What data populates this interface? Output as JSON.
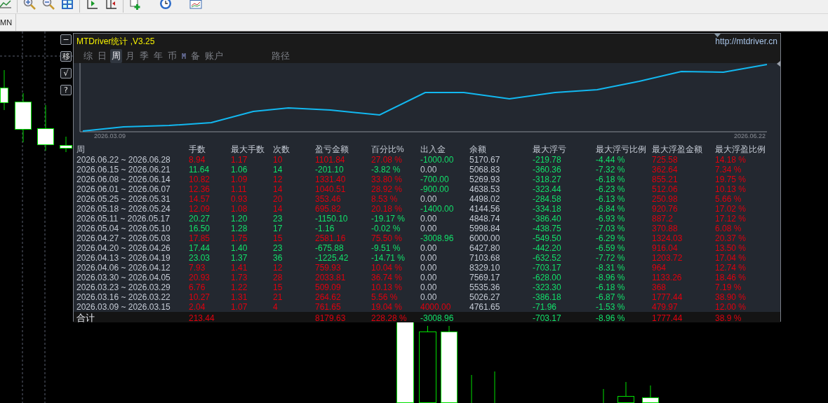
{
  "toolbar": {
    "period_label": "MN"
  },
  "panel": {
    "title": "MTDriver统计 ,V3.25",
    "url": "http://mtdriver.cn",
    "side_buttons": [
      "−",
      "移",
      "√",
      "?"
    ],
    "tabs": [
      {
        "label": "综",
        "kind": "char",
        "selected": false
      },
      {
        "label": "日",
        "kind": "char",
        "selected": false
      },
      {
        "label": "周",
        "kind": "char",
        "selected": true
      },
      {
        "label": "月",
        "kind": "char",
        "selected": false
      },
      {
        "label": "季",
        "kind": "char",
        "selected": false
      },
      {
        "label": "年",
        "kind": "char",
        "selected": false
      },
      {
        "label": "币",
        "kind": "char",
        "selected": false
      },
      {
        "label": "M",
        "kind": "mark",
        "selected": false
      },
      {
        "label": "备",
        "kind": "char",
        "selected": false
      },
      {
        "label": "账户",
        "kind": "char",
        "selected": false
      },
      {
        "label": "路径",
        "kind": "char",
        "selected": false
      }
    ],
    "chart": {
      "start_label": "2026.03.09",
      "end_label": "2026.06.22"
    },
    "table": {
      "columns": [
        "周",
        "手数",
        "最大手数",
        "次数",
        "盈亏金额",
        "百分比%",
        "出入金",
        "余额",
        "最大浮亏",
        "最大浮亏比例",
        "最大浮盈金额",
        "最大浮盈比例"
      ],
      "rows": [
        {
          "cells": [
            {
              "text": "2026.06.22 ~ 2026.06.28",
              "color": "#c4cad4"
            },
            {
              "text": "8.94",
              "color": "#e0000e"
            },
            {
              "text": "1.17",
              "color": "#e0000e"
            },
            {
              "text": "10",
              "color": "#e0000e"
            },
            {
              "text": "1101.84",
              "color": "#e0000e"
            },
            {
              "text": "27.08 %",
              "color": "#e0000e"
            },
            {
              "text": "-1000.00",
              "color": "#12e06a"
            },
            {
              "text": "5170.67",
              "color": "#c4cad4"
            },
            {
              "text": "-219.78",
              "color": "#12e06a"
            },
            {
              "text": "-4.44 %",
              "color": "#12e06a"
            },
            {
              "text": "725.58",
              "color": "#e0000e"
            },
            {
              "text": "14.18 %",
              "color": "#e0000e"
            }
          ]
        },
        {
          "cells": [
            {
              "text": "2026.06.15 ~ 2026.06.21",
              "color": "#c4cad4"
            },
            {
              "text": "11.64",
              "color": "#12e06a"
            },
            {
              "text": "1.06",
              "color": "#12e06a"
            },
            {
              "text": "14",
              "color": "#12e06a"
            },
            {
              "text": "-201.10",
              "color": "#12e06a"
            },
            {
              "text": "-3.82 %",
              "color": "#12e06a"
            },
            {
              "text": "0.00",
              "color": "#c4cad4"
            },
            {
              "text": "5068.83",
              "color": "#c4cad4"
            },
            {
              "text": "-360.36",
              "color": "#12e06a"
            },
            {
              "text": "-7.32 %",
              "color": "#12e06a"
            },
            {
              "text": "362.64",
              "color": "#e0000e"
            },
            {
              "text": "7.34 %",
              "color": "#e0000e"
            }
          ]
        },
        {
          "cells": [
            {
              "text": "2026.06.08 ~ 2026.06.14",
              "color": "#c4cad4"
            },
            {
              "text": "10.82",
              "color": "#e0000e"
            },
            {
              "text": "1.09",
              "color": "#e0000e"
            },
            {
              "text": "12",
              "color": "#e0000e"
            },
            {
              "text": "1331.40",
              "color": "#e0000e"
            },
            {
              "text": "33.80 %",
              "color": "#e0000e"
            },
            {
              "text": "-700.00",
              "color": "#12e06a"
            },
            {
              "text": "5269.93",
              "color": "#c4cad4"
            },
            {
              "text": "-318.27",
              "color": "#12e06a"
            },
            {
              "text": "-6.18 %",
              "color": "#12e06a"
            },
            {
              "text": "855.21",
              "color": "#e0000e"
            },
            {
              "text": "19.75 %",
              "color": "#e0000e"
            }
          ]
        },
        {
          "cells": [
            {
              "text": "2026.06.01 ~ 2026.06.07",
              "color": "#c4cad4"
            },
            {
              "text": "12.36",
              "color": "#e0000e"
            },
            {
              "text": "1.11",
              "color": "#e0000e"
            },
            {
              "text": "14",
              "color": "#e0000e"
            },
            {
              "text": "1040.51",
              "color": "#e0000e"
            },
            {
              "text": "28.92 %",
              "color": "#e0000e"
            },
            {
              "text": "-900.00",
              "color": "#12e06a"
            },
            {
              "text": "4638.53",
              "color": "#c4cad4"
            },
            {
              "text": "-323.44",
              "color": "#12e06a"
            },
            {
              "text": "-6.23 %",
              "color": "#12e06a"
            },
            {
              "text": "512.06",
              "color": "#e0000e"
            },
            {
              "text": "10.13 %",
              "color": "#e0000e"
            }
          ]
        },
        {
          "cells": [
            {
              "text": "2026.05.25 ~ 2026.05.31",
              "color": "#c4cad4"
            },
            {
              "text": "14.57",
              "color": "#e0000e"
            },
            {
              "text": "0.93",
              "color": "#e0000e"
            },
            {
              "text": "20",
              "color": "#e0000e"
            },
            {
              "text": "353.46",
              "color": "#e0000e"
            },
            {
              "text": "8.53 %",
              "color": "#e0000e"
            },
            {
              "text": "0.00",
              "color": "#c4cad4"
            },
            {
              "text": "4498.02",
              "color": "#c4cad4"
            },
            {
              "text": "-284.58",
              "color": "#12e06a"
            },
            {
              "text": "-6.13 %",
              "color": "#12e06a"
            },
            {
              "text": "250.98",
              "color": "#e0000e"
            },
            {
              "text": "5.66 %",
              "color": "#e0000e"
            }
          ]
        },
        {
          "cells": [
            {
              "text": "2026.05.18 ~ 2026.05.24",
              "color": "#c4cad4"
            },
            {
              "text": "12.09",
              "color": "#e0000e"
            },
            {
              "text": "1.08",
              "color": "#e0000e"
            },
            {
              "text": "14",
              "color": "#e0000e"
            },
            {
              "text": "695.82",
              "color": "#e0000e"
            },
            {
              "text": "20.18 %",
              "color": "#e0000e"
            },
            {
              "text": "-1400.00",
              "color": "#12e06a"
            },
            {
              "text": "4144.56",
              "color": "#c4cad4"
            },
            {
              "text": "-334.18",
              "color": "#12e06a"
            },
            {
              "text": "-6.84 %",
              "color": "#12e06a"
            },
            {
              "text": "920.76",
              "color": "#e0000e"
            },
            {
              "text": "17.02 %",
              "color": "#e0000e"
            }
          ]
        },
        {
          "cells": [
            {
              "text": "2026.05.11 ~ 2026.05.17",
              "color": "#c4cad4"
            },
            {
              "text": "20.27",
              "color": "#12e06a"
            },
            {
              "text": "1.20",
              "color": "#12e06a"
            },
            {
              "text": "23",
              "color": "#12e06a"
            },
            {
              "text": "-1150.10",
              "color": "#12e06a"
            },
            {
              "text": "-19.17 %",
              "color": "#12e06a"
            },
            {
              "text": "0.00",
              "color": "#c4cad4"
            },
            {
              "text": "4848.74",
              "color": "#c4cad4"
            },
            {
              "text": "-386.40",
              "color": "#12e06a"
            },
            {
              "text": "-6.93 %",
              "color": "#12e06a"
            },
            {
              "text": "887.2",
              "color": "#e0000e"
            },
            {
              "text": "17.12 %",
              "color": "#e0000e"
            }
          ]
        },
        {
          "cells": [
            {
              "text": "2026.05.04 ~ 2026.05.10",
              "color": "#c4cad4"
            },
            {
              "text": "16.50",
              "color": "#12e06a"
            },
            {
              "text": "1.28",
              "color": "#12e06a"
            },
            {
              "text": "17",
              "color": "#12e06a"
            },
            {
              "text": "-1.16",
              "color": "#12e06a"
            },
            {
              "text": "-0.02 %",
              "color": "#12e06a"
            },
            {
              "text": "0.00",
              "color": "#c4cad4"
            },
            {
              "text": "5998.84",
              "color": "#c4cad4"
            },
            {
              "text": "-438.75",
              "color": "#12e06a"
            },
            {
              "text": "-7.03 %",
              "color": "#12e06a"
            },
            {
              "text": "370.88",
              "color": "#e0000e"
            },
            {
              "text": "6.08 %",
              "color": "#e0000e"
            }
          ]
        },
        {
          "cells": [
            {
              "text": "2026.04.27 ~ 2026.05.03",
              "color": "#c4cad4"
            },
            {
              "text": "17.85",
              "color": "#e0000e"
            },
            {
              "text": "1.75",
              "color": "#e0000e"
            },
            {
              "text": "15",
              "color": "#e0000e"
            },
            {
              "text": "2581.16",
              "color": "#e0000e"
            },
            {
              "text": "75.50 %",
              "color": "#e0000e"
            },
            {
              "text": "-3008.96",
              "color": "#12e06a"
            },
            {
              "text": "6000.00",
              "color": "#c4cad4"
            },
            {
              "text": "-549.50",
              "color": "#12e06a"
            },
            {
              "text": "-6.29 %",
              "color": "#12e06a"
            },
            {
              "text": "1324.03",
              "color": "#e0000e"
            },
            {
              "text": "20.37 %",
              "color": "#e0000e"
            }
          ]
        },
        {
          "cells": [
            {
              "text": "2026.04.20 ~ 2026.04.26",
              "color": "#c4cad4"
            },
            {
              "text": "17.44",
              "color": "#12e06a"
            },
            {
              "text": "1.40",
              "color": "#12e06a"
            },
            {
              "text": "23",
              "color": "#12e06a"
            },
            {
              "text": "-675.88",
              "color": "#12e06a"
            },
            {
              "text": "-9.51 %",
              "color": "#12e06a"
            },
            {
              "text": "0.00",
              "color": "#c4cad4"
            },
            {
              "text": "6427.80",
              "color": "#c4cad4"
            },
            {
              "text": "-442.20",
              "color": "#12e06a"
            },
            {
              "text": "-6.59 %",
              "color": "#12e06a"
            },
            {
              "text": "916.04",
              "color": "#e0000e"
            },
            {
              "text": "13.50 %",
              "color": "#e0000e"
            }
          ]
        },
        {
          "cells": [
            {
              "text": "2026.04.13 ~ 2026.04.19",
              "color": "#c4cad4"
            },
            {
              "text": "23.03",
              "color": "#12e06a"
            },
            {
              "text": "1.37",
              "color": "#12e06a"
            },
            {
              "text": "36",
              "color": "#12e06a"
            },
            {
              "text": "-1225.42",
              "color": "#12e06a"
            },
            {
              "text": "-14.71 %",
              "color": "#12e06a"
            },
            {
              "text": "0.00",
              "color": "#c4cad4"
            },
            {
              "text": "7103.68",
              "color": "#c4cad4"
            },
            {
              "text": "-632.52",
              "color": "#12e06a"
            },
            {
              "text": "-7.72 %",
              "color": "#12e06a"
            },
            {
              "text": "1203.72",
              "color": "#e0000e"
            },
            {
              "text": "17.04 %",
              "color": "#e0000e"
            }
          ]
        },
        {
          "cells": [
            {
              "text": "2026.04.06 ~ 2026.04.12",
              "color": "#c4cad4"
            },
            {
              "text": "7.93",
              "color": "#e0000e"
            },
            {
              "text": "1.41",
              "color": "#e0000e"
            },
            {
              "text": "12",
              "color": "#e0000e"
            },
            {
              "text": "759.93",
              "color": "#e0000e"
            },
            {
              "text": "10.04 %",
              "color": "#e0000e"
            },
            {
              "text": "0.00",
              "color": "#c4cad4"
            },
            {
              "text": "8329.10",
              "color": "#c4cad4"
            },
            {
              "text": "-703.17",
              "color": "#12e06a"
            },
            {
              "text": "-8.31 %",
              "color": "#12e06a"
            },
            {
              "text": "964",
              "color": "#e0000e"
            },
            {
              "text": "12.74 %",
              "color": "#e0000e"
            }
          ]
        },
        {
          "cells": [
            {
              "text": "2026.03.30 ~ 2026.04.05",
              "color": "#c4cad4"
            },
            {
              "text": "20.93",
              "color": "#e0000e"
            },
            {
              "text": "1.73",
              "color": "#e0000e"
            },
            {
              "text": "28",
              "color": "#e0000e"
            },
            {
              "text": "2033.81",
              "color": "#e0000e"
            },
            {
              "text": "36.74 %",
              "color": "#e0000e"
            },
            {
              "text": "0.00",
              "color": "#c4cad4"
            },
            {
              "text": "7569.17",
              "color": "#c4cad4"
            },
            {
              "text": "-628.00",
              "color": "#12e06a"
            },
            {
              "text": "-8.96 %",
              "color": "#12e06a"
            },
            {
              "text": "1133.26",
              "color": "#e0000e"
            },
            {
              "text": "18.46 %",
              "color": "#e0000e"
            }
          ]
        },
        {
          "cells": [
            {
              "text": "2026.03.23 ~ 2026.03.29",
              "color": "#c4cad4"
            },
            {
              "text": "6.76",
              "color": "#e0000e"
            },
            {
              "text": "1.22",
              "color": "#e0000e"
            },
            {
              "text": "15",
              "color": "#e0000e"
            },
            {
              "text": "509.09",
              "color": "#e0000e"
            },
            {
              "text": "10.13 %",
              "color": "#e0000e"
            },
            {
              "text": "0.00",
              "color": "#c4cad4"
            },
            {
              "text": "5535.36",
              "color": "#c4cad4"
            },
            {
              "text": "-323.30",
              "color": "#12e06a"
            },
            {
              "text": "-6.18 %",
              "color": "#12e06a"
            },
            {
              "text": "368",
              "color": "#e0000e"
            },
            {
              "text": "7.19 %",
              "color": "#e0000e"
            }
          ]
        },
        {
          "cells": [
            {
              "text": "2026.03.16 ~ 2026.03.22",
              "color": "#c4cad4"
            },
            {
              "text": "10.27",
              "color": "#e0000e"
            },
            {
              "text": "1.31",
              "color": "#e0000e"
            },
            {
              "text": "21",
              "color": "#e0000e"
            },
            {
              "text": "264.62",
              "color": "#e0000e"
            },
            {
              "text": "5.56 %",
              "color": "#e0000e"
            },
            {
              "text": "0.00",
              "color": "#c4cad4"
            },
            {
              "text": "5026.27",
              "color": "#c4cad4"
            },
            {
              "text": "-386.18",
              "color": "#12e06a"
            },
            {
              "text": "-6.87 %",
              "color": "#12e06a"
            },
            {
              "text": "1777.44",
              "color": "#e0000e"
            },
            {
              "text": "38.90 %",
              "color": "#e0000e"
            }
          ]
        },
        {
          "cells": [
            {
              "text": "2026.03.09 ~ 2026.03.15",
              "color": "#c4cad4"
            },
            {
              "text": "2.04",
              "color": "#e0000e"
            },
            {
              "text": "1.07",
              "color": "#e0000e"
            },
            {
              "text": "4",
              "color": "#e0000e"
            },
            {
              "text": "761.65",
              "color": "#e0000e"
            },
            {
              "text": "19.04 %",
              "color": "#e0000e"
            },
            {
              "text": "4000.00",
              "color": "#e0000e"
            },
            {
              "text": "4761.65",
              "color": "#c4cad4"
            },
            {
              "text": "-71.96",
              "color": "#12e06a"
            },
            {
              "text": "-1.53 %",
              "color": "#12e06a"
            },
            {
              "text": "479.97",
              "color": "#e0000e"
            },
            {
              "text": "12.00 %",
              "color": "#e0000e"
            }
          ]
        }
      ],
      "total": {
        "cells": [
          {
            "text": "合计",
            "color": "#e8eaf0"
          },
          {
            "text": "213.44",
            "color": "#e0000e"
          },
          null,
          null,
          {
            "text": "8179.63",
            "color": "#e0000e"
          },
          {
            "text": "228.28 %",
            "color": "#e0000e"
          },
          {
            "text": "-3008.96",
            "color": "#12e06a"
          },
          null,
          {
            "text": "-703.17",
            "color": "#12e06a"
          },
          {
            "text": "-8.96 %",
            "color": "#12e06a"
          },
          {
            "text": "1777.44",
            "color": "#e0000e"
          },
          {
            "text": "38.9 %",
            "color": "#e0000e"
          }
        ]
      }
    }
  }
}
